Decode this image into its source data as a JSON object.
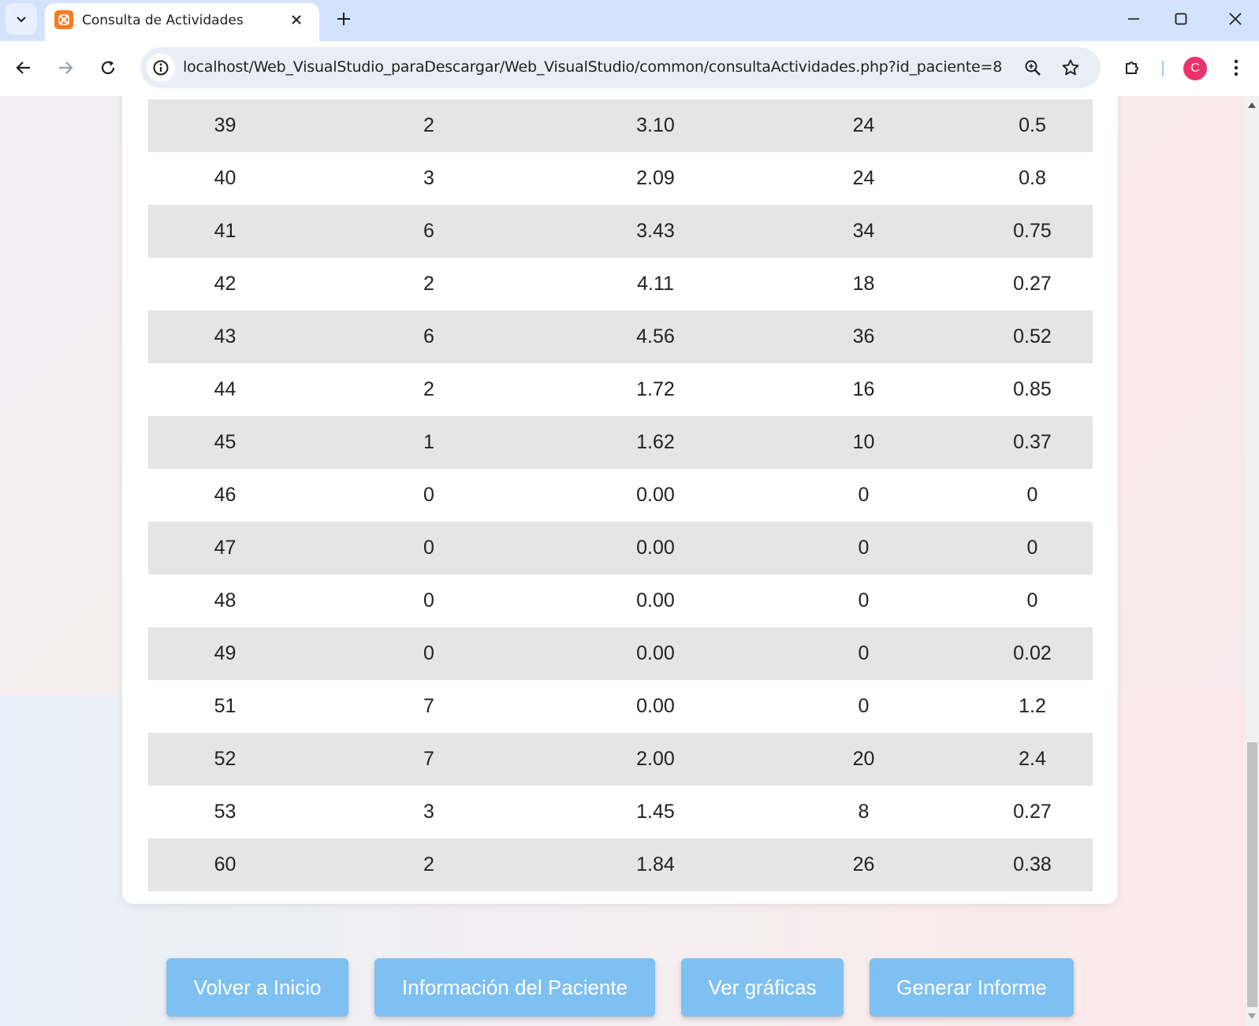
{
  "browser": {
    "tab_title": "Consulta de Actividades",
    "url": "localhost/Web_VisualStudio_paraDescargar/Web_VisualStudio/common/consultaActividades.php?id_paciente=8",
    "profile_initial": "C",
    "tab_icon": "xampp-icon",
    "icons": [
      "tab-search-icon",
      "close-icon",
      "plus-icon",
      "minimize-icon",
      "maximize-icon",
      "close-window-icon",
      "back-arrow-icon",
      "forward-arrow-icon",
      "reload-icon",
      "info-icon",
      "zoom-icon",
      "star-icon",
      "extensions-icon",
      "kebab-menu-icon"
    ]
  },
  "table": {
    "rows": [
      [
        "39",
        "2",
        "3.10",
        "24",
        "0.5"
      ],
      [
        "40",
        "3",
        "2.09",
        "24",
        "0.8"
      ],
      [
        "41",
        "6",
        "3.43",
        "34",
        "0.75"
      ],
      [
        "42",
        "2",
        "4.11",
        "18",
        "0.27"
      ],
      [
        "43",
        "6",
        "4.56",
        "36",
        "0.52"
      ],
      [
        "44",
        "2",
        "1.72",
        "16",
        "0.85"
      ],
      [
        "45",
        "1",
        "1.62",
        "10",
        "0.37"
      ],
      [
        "46",
        "0",
        "0.00",
        "0",
        "0"
      ],
      [
        "47",
        "0",
        "0.00",
        "0",
        "0"
      ],
      [
        "48",
        "0",
        "0.00",
        "0",
        "0"
      ],
      [
        "49",
        "0",
        "0.00",
        "0",
        "0.02"
      ],
      [
        "51",
        "7",
        "0.00",
        "0",
        "1.2"
      ],
      [
        "52",
        "7",
        "2.00",
        "20",
        "2.4"
      ],
      [
        "53",
        "3",
        "1.45",
        "8",
        "0.27"
      ],
      [
        "60",
        "2",
        "1.84",
        "26",
        "0.38"
      ]
    ]
  },
  "actions": {
    "back_home": "Volver a Inicio",
    "patient_info": "Información del Paciente",
    "view_charts": "Ver gráficas",
    "generate_report": "Generar Informe"
  },
  "colors": {
    "button": "#7ec0f1",
    "row_alt": "#e5e5e5",
    "avatar": "#e8336d",
    "tabstrip": "#d3e3fd"
  }
}
